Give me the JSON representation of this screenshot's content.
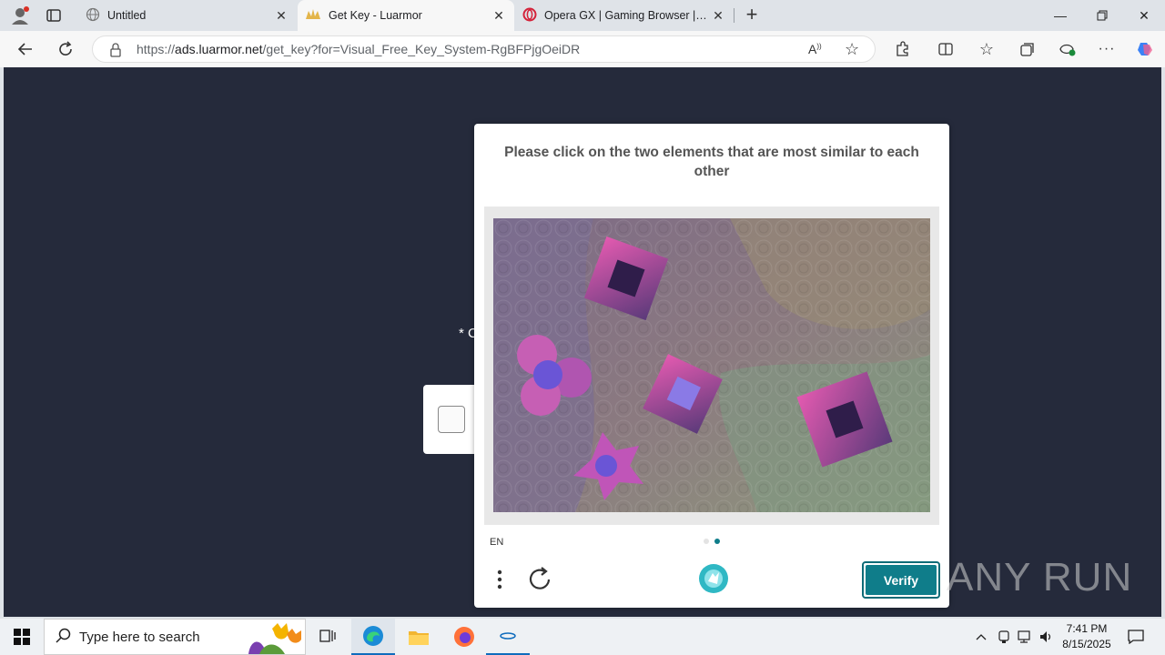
{
  "tabs": [
    {
      "label": "Untitled"
    },
    {
      "label": "Get Key - Luarmor"
    },
    {
      "label": "Opera GX | Gaming Browser | Ope"
    }
  ],
  "address": {
    "scheme": "https://",
    "host": "ads.luarmor.net",
    "path": "/get_key?for=Visual_Free_Key_System-RgBFPjgOeiDR"
  },
  "page": {
    "star_text": "* C"
  },
  "captcha": {
    "prompt": "Please click on the two elements that are most similar to each other",
    "language": "EN",
    "verify_label": "Verify",
    "accent_color": "#0f7d8a",
    "page_indicator": {
      "current": 2,
      "total": 2
    }
  },
  "watermark": "ANY RUN",
  "taskbar": {
    "search_placeholder": "Type here to search",
    "time": "7:41 PM",
    "date": "8/15/2025"
  }
}
